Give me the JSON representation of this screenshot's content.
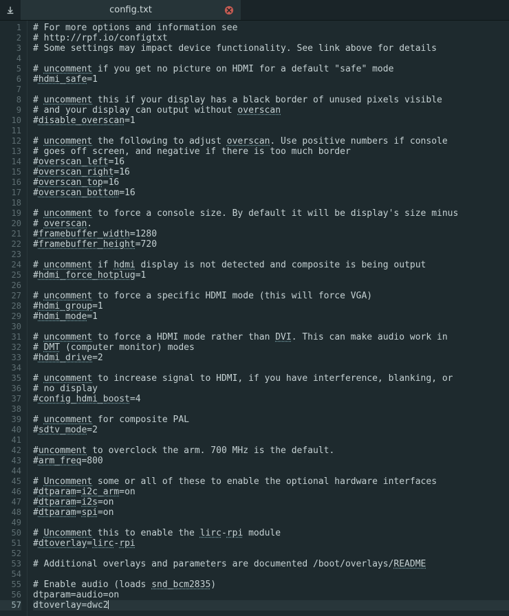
{
  "tab": {
    "title": "config.txt"
  },
  "icons": {
    "download": "download-icon",
    "close": "close-icon"
  },
  "editor": {
    "current_line": 57,
    "lines": [
      {
        "n": 1,
        "segs": [
          [
            "# For more options and information see",
            0
          ]
        ]
      },
      {
        "n": 2,
        "segs": [
          [
            "# http://rpf.io/configtxt",
            0
          ]
        ]
      },
      {
        "n": 3,
        "segs": [
          [
            "# Some settings may impact device functionality. See link above for details",
            0
          ]
        ]
      },
      {
        "n": 4,
        "segs": [
          [
            "",
            0
          ]
        ]
      },
      {
        "n": 5,
        "segs": [
          [
            "# ",
            0
          ],
          [
            "uncomment",
            1
          ],
          [
            " if you get no picture on HDMI for a default \"safe\" mode",
            0
          ]
        ]
      },
      {
        "n": 6,
        "segs": [
          [
            "#",
            0
          ],
          [
            "hdmi_safe",
            1
          ],
          [
            "=1",
            0
          ]
        ]
      },
      {
        "n": 7,
        "segs": [
          [
            "",
            0
          ]
        ]
      },
      {
        "n": 8,
        "segs": [
          [
            "# ",
            0
          ],
          [
            "uncomment",
            1
          ],
          [
            " this if your display has a black border of unused pixels visible",
            0
          ]
        ]
      },
      {
        "n": 9,
        "segs": [
          [
            "# and your display can output without ",
            0
          ],
          [
            "overscan",
            1
          ]
        ]
      },
      {
        "n": 10,
        "segs": [
          [
            "#",
            0
          ],
          [
            "disable_overscan",
            1
          ],
          [
            "=1",
            0
          ]
        ]
      },
      {
        "n": 11,
        "segs": [
          [
            "",
            0
          ]
        ]
      },
      {
        "n": 12,
        "segs": [
          [
            "# ",
            0
          ],
          [
            "uncomment",
            1
          ],
          [
            " the following to adjust ",
            0
          ],
          [
            "overscan",
            1
          ],
          [
            ". Use positive numbers if console",
            0
          ]
        ]
      },
      {
        "n": 13,
        "segs": [
          [
            "# goes off screen, and negative if there is too much border",
            0
          ]
        ]
      },
      {
        "n": 14,
        "segs": [
          [
            "#",
            0
          ],
          [
            "overscan_left",
            1
          ],
          [
            "=16",
            0
          ]
        ]
      },
      {
        "n": 15,
        "segs": [
          [
            "#",
            0
          ],
          [
            "overscan_right",
            1
          ],
          [
            "=16",
            0
          ]
        ]
      },
      {
        "n": 16,
        "segs": [
          [
            "#",
            0
          ],
          [
            "overscan_top",
            1
          ],
          [
            "=16",
            0
          ]
        ]
      },
      {
        "n": 17,
        "segs": [
          [
            "#",
            0
          ],
          [
            "overscan_bottom",
            1
          ],
          [
            "=16",
            0
          ]
        ]
      },
      {
        "n": 18,
        "segs": [
          [
            "",
            0
          ]
        ]
      },
      {
        "n": 19,
        "segs": [
          [
            "# ",
            0
          ],
          [
            "uncomment",
            1
          ],
          [
            " to force a console size. By default it will be display's size minus",
            0
          ]
        ]
      },
      {
        "n": 20,
        "segs": [
          [
            "# ",
            0
          ],
          [
            "overscan",
            1
          ],
          [
            ".",
            0
          ]
        ]
      },
      {
        "n": 21,
        "segs": [
          [
            "#",
            0
          ],
          [
            "framebuffer_width",
            1
          ],
          [
            "=1280",
            0
          ]
        ]
      },
      {
        "n": 22,
        "segs": [
          [
            "#",
            0
          ],
          [
            "framebuffer_height",
            1
          ],
          [
            "=720",
            0
          ]
        ]
      },
      {
        "n": 23,
        "segs": [
          [
            "",
            0
          ]
        ]
      },
      {
        "n": 24,
        "segs": [
          [
            "# ",
            0
          ],
          [
            "uncomment",
            1
          ],
          [
            " if ",
            0
          ],
          [
            "hdmi",
            1
          ],
          [
            " display is not detected and composite is being output",
            0
          ]
        ]
      },
      {
        "n": 25,
        "segs": [
          [
            "#",
            0
          ],
          [
            "hdmi_force_hotplug",
            1
          ],
          [
            "=1",
            0
          ]
        ]
      },
      {
        "n": 26,
        "segs": [
          [
            "",
            0
          ]
        ]
      },
      {
        "n": 27,
        "segs": [
          [
            "# ",
            0
          ],
          [
            "uncomment",
            1
          ],
          [
            " to force a specific HDMI mode (this will force VGA)",
            0
          ]
        ]
      },
      {
        "n": 28,
        "segs": [
          [
            "#",
            0
          ],
          [
            "hdmi_group",
            1
          ],
          [
            "=1",
            0
          ]
        ]
      },
      {
        "n": 29,
        "segs": [
          [
            "#",
            0
          ],
          [
            "hdmi_mode",
            1
          ],
          [
            "=1",
            0
          ]
        ]
      },
      {
        "n": 30,
        "segs": [
          [
            "",
            0
          ]
        ]
      },
      {
        "n": 31,
        "segs": [
          [
            "# ",
            0
          ],
          [
            "uncomment",
            1
          ],
          [
            " to force a HDMI mode rather than ",
            0
          ],
          [
            "DVI",
            1
          ],
          [
            ". This can make audio work in",
            0
          ]
        ]
      },
      {
        "n": 32,
        "segs": [
          [
            "# ",
            0
          ],
          [
            "DMT",
            1
          ],
          [
            " (computer monitor) modes",
            0
          ]
        ]
      },
      {
        "n": 33,
        "segs": [
          [
            "#",
            0
          ],
          [
            "hdmi_drive",
            1
          ],
          [
            "=2",
            0
          ]
        ]
      },
      {
        "n": 34,
        "segs": [
          [
            "",
            0
          ]
        ]
      },
      {
        "n": 35,
        "segs": [
          [
            "# ",
            0
          ],
          [
            "uncomment",
            1
          ],
          [
            " to increase signal to HDMI, if you have interference, blanking, or",
            0
          ]
        ]
      },
      {
        "n": 36,
        "segs": [
          [
            "# no display",
            0
          ]
        ]
      },
      {
        "n": 37,
        "segs": [
          [
            "#",
            0
          ],
          [
            "config_hdmi_boost",
            1
          ],
          [
            "=4",
            0
          ]
        ]
      },
      {
        "n": 38,
        "segs": [
          [
            "",
            0
          ]
        ]
      },
      {
        "n": 39,
        "segs": [
          [
            "# ",
            0
          ],
          [
            "uncomment",
            1
          ],
          [
            " for composite PAL",
            0
          ]
        ]
      },
      {
        "n": 40,
        "segs": [
          [
            "#",
            0
          ],
          [
            "sdtv_mode",
            1
          ],
          [
            "=2",
            0
          ]
        ]
      },
      {
        "n": 41,
        "segs": [
          [
            "",
            0
          ]
        ]
      },
      {
        "n": 42,
        "segs": [
          [
            "#",
            0
          ],
          [
            "uncomment",
            1
          ],
          [
            " to overclock the arm. 700 MHz is the default.",
            0
          ]
        ]
      },
      {
        "n": 43,
        "segs": [
          [
            "#",
            0
          ],
          [
            "arm_freq",
            1
          ],
          [
            "=800",
            0
          ]
        ]
      },
      {
        "n": 44,
        "segs": [
          [
            "",
            0
          ]
        ]
      },
      {
        "n": 45,
        "segs": [
          [
            "# ",
            0
          ],
          [
            "Uncomment",
            1
          ],
          [
            " some or all of these to enable the optional hardware interfaces",
            0
          ]
        ]
      },
      {
        "n": 46,
        "segs": [
          [
            "#",
            0
          ],
          [
            "dtparam",
            1
          ],
          [
            "=",
            0
          ],
          [
            "i2c_arm",
            1
          ],
          [
            "=on",
            0
          ]
        ]
      },
      {
        "n": 47,
        "segs": [
          [
            "#",
            0
          ],
          [
            "dtparam",
            1
          ],
          [
            "=",
            0
          ],
          [
            "i2s",
            1
          ],
          [
            "=on",
            0
          ]
        ]
      },
      {
        "n": 48,
        "segs": [
          [
            "#",
            0
          ],
          [
            "dtparam",
            1
          ],
          [
            "=",
            0
          ],
          [
            "spi",
            1
          ],
          [
            "=on",
            0
          ]
        ]
      },
      {
        "n": 49,
        "segs": [
          [
            "",
            0
          ]
        ]
      },
      {
        "n": 50,
        "segs": [
          [
            "# ",
            0
          ],
          [
            "Uncomment",
            1
          ],
          [
            " this to enable the ",
            0
          ],
          [
            "lirc",
            1
          ],
          [
            "-",
            0
          ],
          [
            "rpi",
            1
          ],
          [
            " module",
            0
          ]
        ]
      },
      {
        "n": 51,
        "segs": [
          [
            "#",
            0
          ],
          [
            "dtoverlay",
            1
          ],
          [
            "=",
            0
          ],
          [
            "lirc",
            1
          ],
          [
            "-",
            0
          ],
          [
            "rpi",
            1
          ]
        ]
      },
      {
        "n": 52,
        "segs": [
          [
            "",
            0
          ]
        ]
      },
      {
        "n": 53,
        "segs": [
          [
            "# Additional overlays and parameters are documented /boot/overlays/",
            0
          ],
          [
            "README",
            1
          ]
        ]
      },
      {
        "n": 54,
        "segs": [
          [
            "",
            0
          ]
        ]
      },
      {
        "n": 55,
        "segs": [
          [
            "# Enable audio (loads ",
            0
          ],
          [
            "snd_bcm2835",
            1
          ],
          [
            ")",
            0
          ]
        ]
      },
      {
        "n": 56,
        "segs": [
          [
            "dtparam=audio=on",
            0
          ]
        ]
      },
      {
        "n": 57,
        "segs": [
          [
            "dtoverlay=dwc2",
            0
          ]
        ]
      }
    ]
  }
}
